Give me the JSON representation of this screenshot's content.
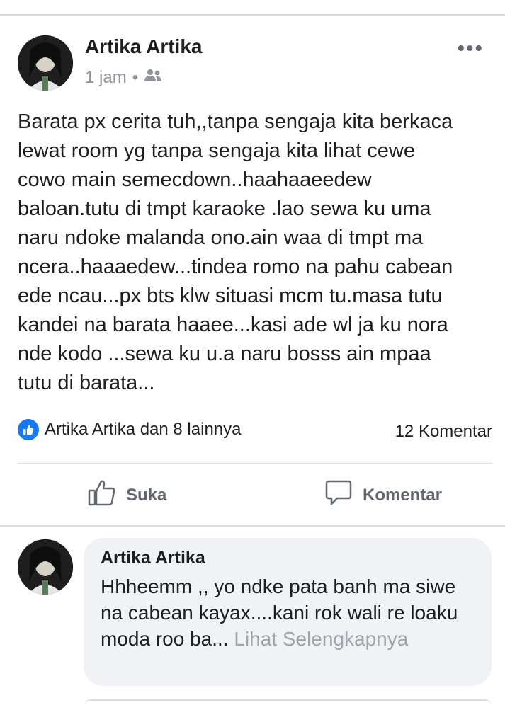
{
  "post": {
    "author": "Artika Artika",
    "time": "1 jam",
    "separator": "•",
    "more_label": "•••",
    "text": "Barata px cerita tuh,,tanpa sengaja kita berkaca\nlewat room yg tanpa sengaja kita lihat cewe\ncowo main semecdown..haahaaeedew\nbaloan.tutu di tmpt karaoke .lao sewa ku uma\nnaru ndoke malanda ono.ain waa di tmpt ma\nncera..haaaedew...tindea romo na pahu cabean\nede ncau...px bts klw situasi mcm tu.masa tutu\nkandei na barata haaee...kasi ade wl ja ku nora\nnde kodo ...sewa ku u.a naru bosss ain mpaa\ntutu di barata..."
  },
  "reactions": {
    "summary": "Artika Artika dan 8 lainnya",
    "comments": "12 Komentar"
  },
  "actions": {
    "like_label": "Suka",
    "comment_label": "Komentar"
  },
  "comment": {
    "author": "Artika Artika",
    "text": "Hhheemm ,, yo ndke pata banh ma siwe na cabean kayax....kani rok wali re loaku moda roo ba...",
    "see_more": "Lihat Selengkapnya"
  },
  "colors": {
    "accent": "#1877f2",
    "muted": "#90949c",
    "bubble": "#f0f2f5"
  },
  "icons": {
    "audience": "friends-icon",
    "like": "thumbs-up-icon",
    "comment": "comment-bubble-icon"
  }
}
